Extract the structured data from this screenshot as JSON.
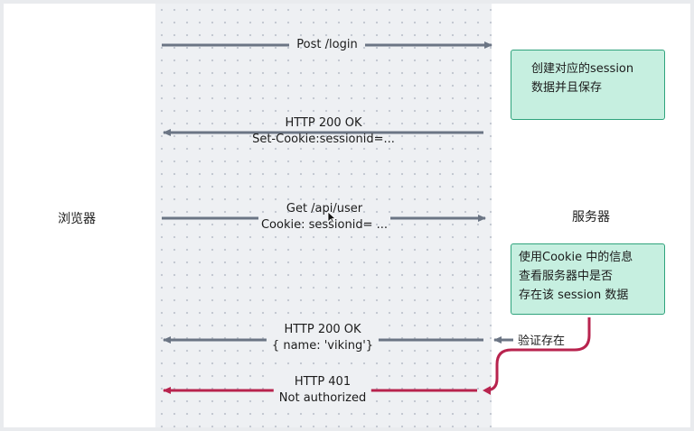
{
  "actors": {
    "browser": "浏览器",
    "server": "服务器"
  },
  "messages": {
    "login": "Post /login",
    "ok1_line1": "HTTP 200 OK",
    "ok1_line2": "Set-Cookie:sessionid=...",
    "get_line1": "Get /api/user",
    "get_line2": "Cookie: sessionid= ...",
    "ok2_line1": "HTTP 200 OK",
    "ok2_line2": "{ name: 'viking'}",
    "err_line1": "HTTP 401",
    "err_line2": "Not authorized"
  },
  "notes": {
    "create_line1": "创建对应的session",
    "create_line2": "数据并且保存",
    "check_line1": "使用Cookie 中的信息",
    "check_line2": "查看服务器中是否",
    "check_line3": "存在该 session 数据"
  },
  "verify_label": "验证存在",
  "colors": {
    "arrow_gray": "#6b7584",
    "arrow_red": "#b8234e",
    "note_fill": "#c6efe0",
    "note_border": "#2fa37c"
  }
}
